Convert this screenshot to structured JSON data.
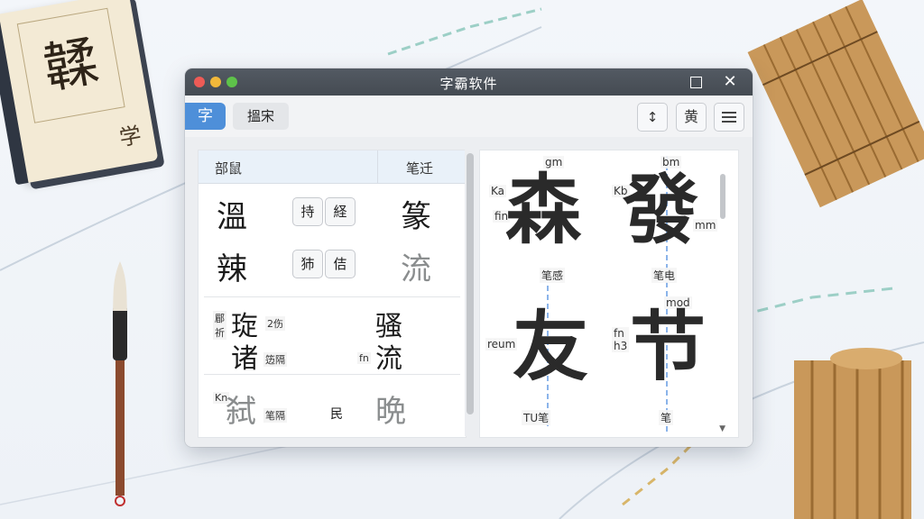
{
  "window": {
    "title": "字霸软件"
  },
  "toolbar": {
    "tab_char": "字",
    "tab_search": "搵宋",
    "sort_label": "↕",
    "huang_label": "黄",
    "menu_icon": "menu-icon"
  },
  "left_pane": {
    "header": {
      "col_a": "部鼠",
      "col_b": "笔迁"
    },
    "rows": [
      {
        "big_a": "溫",
        "chip_1": "持",
        "chip_2": "経",
        "big_b": "篆"
      },
      {
        "big_a": "辣",
        "chip_1": "犻",
        "chip_2": "佶",
        "big_b": "流"
      }
    ],
    "grid2": {
      "a_label": "郿\n祈",
      "a_char_1": "琁",
      "a_char_2": "诸",
      "a_tag_1": "2伤",
      "a_tag_2": "笾隔",
      "b_char_1": "骚",
      "b_char_2": "流",
      "b_tag": "fn"
    },
    "grid3": {
      "a_tag": "Kn",
      "a_char": "弑",
      "a_note": "笔隔",
      "mid": "民",
      "b_char": "晩"
    }
  },
  "right_pane": {
    "chars": [
      {
        "char": "森",
        "top": "gm",
        "left_1": "Ka",
        "left_2": "fin",
        "bottom": "笔感"
      },
      {
        "char": "發",
        "top": "bm",
        "left_1": "Kb",
        "right": "mm",
        "bottom": "笔电"
      },
      {
        "char": "友",
        "left_1": "reum",
        "bottom": "TU笔"
      },
      {
        "char": "节",
        "top": "mod",
        "left_1": "fn\nh3",
        "bottom": "笔"
      }
    ]
  },
  "decor": {
    "book_title": "韖",
    "book_sub": "学"
  }
}
